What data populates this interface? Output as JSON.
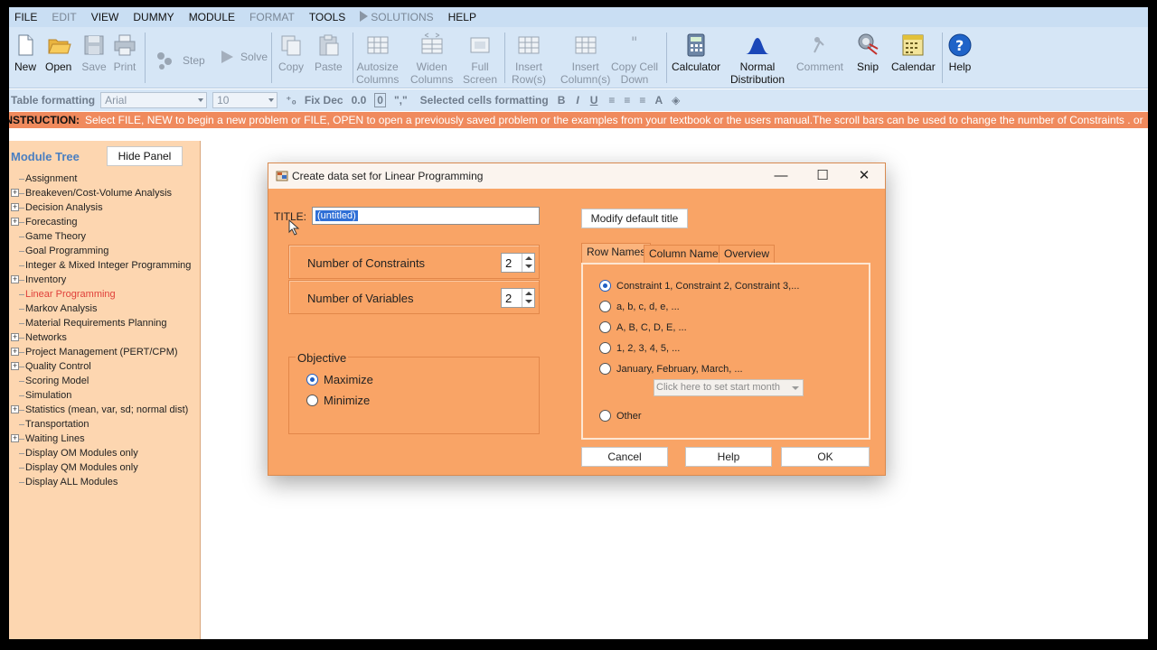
{
  "menu": [
    {
      "label": "FILE",
      "disabled": false
    },
    {
      "label": "EDIT",
      "disabled": true
    },
    {
      "label": "VIEW",
      "disabled": false
    },
    {
      "label": "DUMMY",
      "disabled": false
    },
    {
      "label": "MODULE",
      "disabled": false
    },
    {
      "label": "FORMAT",
      "disabled": true
    },
    {
      "label": "TOOLS",
      "disabled": false
    },
    {
      "label": "SOLUTIONS",
      "disabled": true
    },
    {
      "label": "HELP",
      "disabled": false
    }
  ],
  "toolbar": {
    "new": "New",
    "open": "Open",
    "save": "Save",
    "print": "Print",
    "step": "Step",
    "solve": "Solve",
    "copy": "Copy",
    "paste": "Paste",
    "autosize": [
      "Autosize",
      "Columns"
    ],
    "widen": [
      "Widen",
      "Columns"
    ],
    "fullscreen": [
      "Full",
      "Screen"
    ],
    "insert_rows": [
      "Insert",
      "Row(s)"
    ],
    "insert_cols": [
      "Insert",
      "Column(s)"
    ],
    "copy_cell": [
      "Copy Cell",
      "Down"
    ],
    "calculator": "Calculator",
    "normal_dist": [
      "Normal",
      "Distribution"
    ],
    "comment": "Comment",
    "snip": "Snip",
    "calendar": "Calendar",
    "help": "Help"
  },
  "formatbar": {
    "table_formatting": "Table formatting",
    "font": "Arial",
    "size": "10",
    "fix_dec": "Fix Dec",
    "dec_value": "0.0",
    "zero_btn": "0",
    "comma_btn": "\",\"",
    "selected_cells": "Selected cells formatting",
    "bold": "B",
    "italic": "I",
    "underline": "U"
  },
  "instruction": {
    "label": "INSTRUCTION:",
    "text": "Select FILE, NEW to begin a new problem or FILE, OPEN to open a previously saved problem or the examples from your textbook or the users manual.The scroll bars can be used to change the number of Constraints . or"
  },
  "module_panel": {
    "title": "Module Tree",
    "hide_button": "Hide Panel",
    "items": [
      {
        "label": "Assignment",
        "expandable": false,
        "active": false
      },
      {
        "label": "Breakeven/Cost-Volume Analysis",
        "expandable": true,
        "active": false
      },
      {
        "label": "Decision Analysis",
        "expandable": true,
        "active": false
      },
      {
        "label": "Forecasting",
        "expandable": true,
        "active": false
      },
      {
        "label": "Game Theory",
        "expandable": false,
        "active": false
      },
      {
        "label": "Goal Programming",
        "expandable": false,
        "active": false
      },
      {
        "label": "Integer & Mixed Integer Programming",
        "expandable": false,
        "active": false
      },
      {
        "label": "Inventory",
        "expandable": true,
        "active": false
      },
      {
        "label": "Linear Programming",
        "expandable": false,
        "active": true
      },
      {
        "label": "Markov Analysis",
        "expandable": false,
        "active": false
      },
      {
        "label": "Material Requirements Planning",
        "expandable": false,
        "active": false
      },
      {
        "label": "Networks",
        "expandable": true,
        "active": false
      },
      {
        "label": "Project Management (PERT/CPM)",
        "expandable": true,
        "active": false
      },
      {
        "label": "Quality Control",
        "expandable": true,
        "active": false
      },
      {
        "label": "Scoring Model",
        "expandable": false,
        "active": false
      },
      {
        "label": "Simulation",
        "expandable": false,
        "active": false
      },
      {
        "label": "Statistics (mean, var, sd; normal dist)",
        "expandable": true,
        "active": false
      },
      {
        "label": "Transportation",
        "expandable": false,
        "active": false
      },
      {
        "label": "Waiting Lines",
        "expandable": true,
        "active": false
      },
      {
        "label": "Display OM Modules only",
        "expandable": false,
        "active": false
      },
      {
        "label": "Display QM Modules only",
        "expandable": false,
        "active": false
      },
      {
        "label": "Display ALL Modules",
        "expandable": false,
        "active": false
      }
    ]
  },
  "dialog": {
    "title": "Create data set for Linear Programming",
    "title_label": "TITLE:",
    "title_value": "(untitled)",
    "modify_button": "Modify default title",
    "constraints_label": "Number of Constraints",
    "constraints_value": "2",
    "variables_label": "Number of Variables",
    "variables_value": "2",
    "objective_label": "Objective",
    "objective_options": [
      "Maximize",
      "Minimize"
    ],
    "objective_selected": 0,
    "tabs": [
      "Row Names",
      "Column Names",
      "Overview"
    ],
    "active_tab": 0,
    "row_name_options": [
      "Constraint 1, Constraint 2, Constraint 3,...",
      "a, b, c, d, e, ...",
      "A, B, C, D, E, ...",
      "1, 2, 3, 4, 5, ...",
      "January, February, March, ...",
      "Other"
    ],
    "row_name_selected": 0,
    "month_select": "Click here to set start month",
    "buttons": {
      "cancel": "Cancel",
      "help": "Help",
      "ok": "OK"
    }
  },
  "colors": {
    "menu_bg": "#c9def3",
    "toolbar_bg": "#d6e6f6",
    "instruction_bg": "#f08a5d",
    "panel_bg": "#fdd6b0",
    "dialog_bg": "#f9a466",
    "active_module": "#e0403a",
    "accent": "#1f5fc4"
  }
}
